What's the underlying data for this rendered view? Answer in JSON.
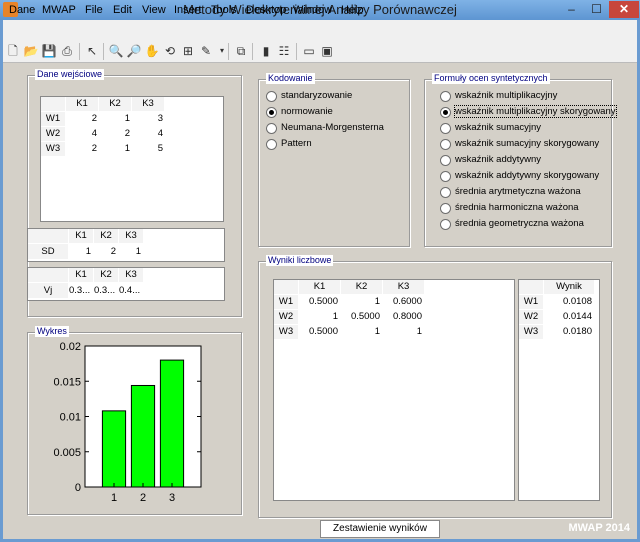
{
  "window": {
    "title": "Metody Wielokryterialnej Analizy Porównawczej",
    "close": "✕",
    "minimize": "‒",
    "maximize": "☐"
  },
  "menu": [
    "Dane",
    "MWAP",
    "File",
    "Edit",
    "View",
    "Insert",
    "Tools",
    "Desktop",
    "Window",
    "Help"
  ],
  "toolbar_icons": [
    "new-file-icon",
    "open-folder-icon",
    "save-icon",
    "print-icon",
    "pointer-icon",
    "zoom-in-icon",
    "zoom-out-icon",
    "pan-icon",
    "rotate-icon",
    "data-cursor-icon",
    "brush-icon",
    "link-icon",
    "colorbar-icon",
    "legend-icon",
    "hide-plot-tools-icon",
    "show-plot-tools-icon"
  ],
  "input_panel": {
    "title": "Dane wejściowe",
    "table": {
      "columns": [
        "K1",
        "K2",
        "K3"
      ],
      "rows": [
        {
          "label": "W1",
          "values": [
            "2",
            "1",
            "3"
          ]
        },
        {
          "label": "W2",
          "values": [
            "4",
            "2",
            "4"
          ]
        },
        {
          "label": "W3",
          "values": [
            "2",
            "1",
            "5"
          ]
        }
      ]
    },
    "sd_table": {
      "columns": [
        "K1",
        "K2",
        "K3"
      ],
      "row_label": "SD",
      "values": [
        "1",
        "2",
        "1"
      ]
    },
    "vj_table": {
      "columns": [
        "K1",
        "K2",
        "K3"
      ],
      "row_label": "Vj",
      "values": [
        "0.3...",
        "0.3...",
        "0.4..."
      ]
    }
  },
  "coding_panel": {
    "title": "Kodowanie",
    "options": [
      {
        "label": "standaryzowanie",
        "selected": false
      },
      {
        "label": "normowanie",
        "selected": true
      },
      {
        "label": "Neumana-Morgensterna",
        "selected": false
      },
      {
        "label": "Pattern",
        "selected": false
      }
    ]
  },
  "formulas_panel": {
    "title": "Formuły ocen syntetycznych",
    "options": [
      {
        "label": "wskaźnik multiplikacyjny",
        "selected": false
      },
      {
        "label": "wskaźnik multiplikacyjny skorygowany",
        "selected": true
      },
      {
        "label": "wskaźnik sumacyjny",
        "selected": false
      },
      {
        "label": "wskaźnik sumacyjny skorygowany",
        "selected": false
      },
      {
        "label": "wskaźnik addytywny",
        "selected": false
      },
      {
        "label": "wskaźnik addytywny skorygowany",
        "selected": false
      },
      {
        "label": "średnia arytmetyczna ważona",
        "selected": false
      },
      {
        "label": "średnia harmoniczna ważona",
        "selected": false
      },
      {
        "label": "średnia geometryczna ważona",
        "selected": false
      }
    ]
  },
  "results_panel": {
    "title": "Wyniki liczbowe",
    "matrix": {
      "columns": [
        "K1",
        "K2",
        "K3"
      ],
      "rows": [
        {
          "label": "W1",
          "values": [
            "0.5000",
            "1",
            "0.6000"
          ]
        },
        {
          "label": "W2",
          "values": [
            "1",
            "0.5000",
            "0.8000"
          ]
        },
        {
          "label": "W3",
          "values": [
            "0.5000",
            "1",
            "1"
          ]
        }
      ]
    },
    "score": {
      "column": "Wynik",
      "rows": [
        {
          "label": "W1",
          "value": "0.0108"
        },
        {
          "label": "W2",
          "value": "0.0144"
        },
        {
          "label": "W3",
          "value": "0.0180"
        }
      ]
    }
  },
  "chart_panel": {
    "title": "Wykres"
  },
  "chart_data": {
    "type": "bar",
    "categories": [
      "1",
      "2",
      "3"
    ],
    "values": [
      0.0108,
      0.0144,
      0.018
    ],
    "ylim": [
      0,
      0.02
    ],
    "yticks": [
      "0",
      "0.005",
      "0.01",
      "0.015",
      "0.02"
    ],
    "bar_color": "#00ff00"
  },
  "footer": {
    "summary_button": "Zestawienie wyników",
    "brand": "MWAP  2014"
  }
}
